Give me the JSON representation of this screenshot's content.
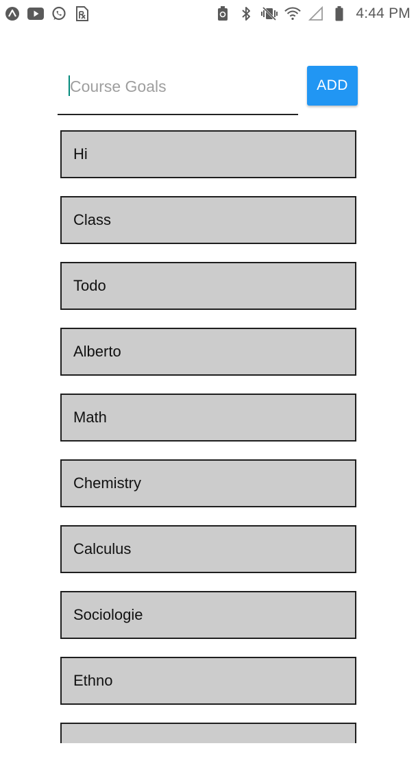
{
  "status_bar": {
    "time": "4:44 PM",
    "left_icons": [
      "expo-icon",
      "youtube-icon",
      "whatsapp-icon",
      "prescription-icon"
    ],
    "right_icons": [
      "battery-saver-icon",
      "bluetooth-icon",
      "vibrate-icon",
      "wifi-icon",
      "no-signal-icon",
      "battery-icon"
    ]
  },
  "input": {
    "value": "",
    "placeholder": "Course Goals"
  },
  "add_button": {
    "label": "ADD",
    "color": "#2196f3"
  },
  "goals": [
    "Hi",
    "Class",
    "Todo",
    "Alberto",
    "Math",
    "Chemistry",
    "Calculus",
    "Sociologie",
    "Ethno"
  ],
  "colors": {
    "item_background": "#cccccc",
    "item_border": "#1e1e1e",
    "caret": "#00897b"
  }
}
